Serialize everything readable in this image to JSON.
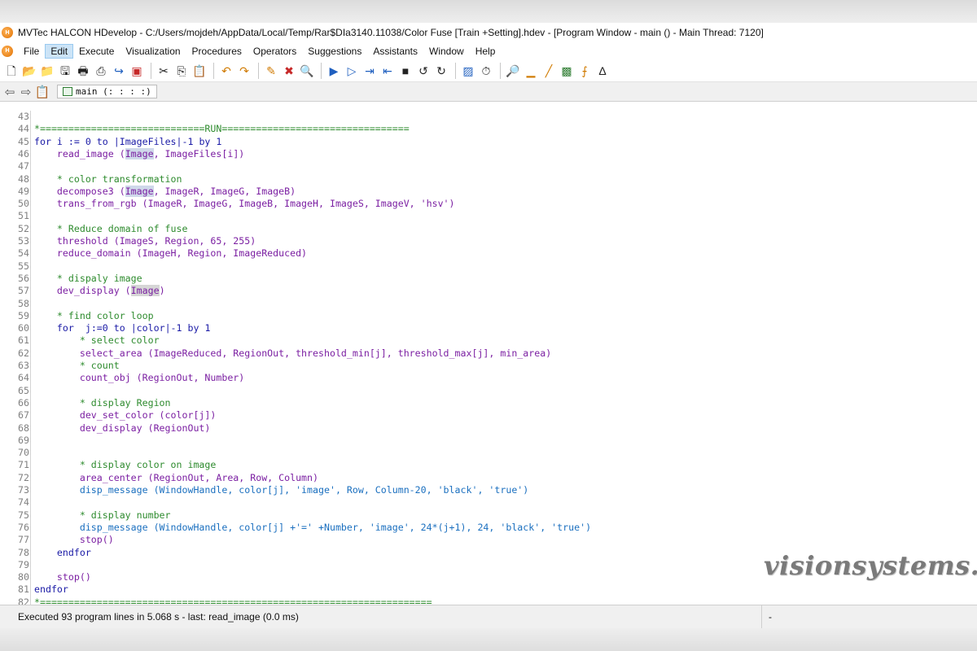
{
  "window": {
    "title": "MVTec HALCON HDevelop - C:/Users/mojdeh/AppData/Local/Temp/Rar$DIa3140.11038/Color Fuse [Train +Setting].hdev - [Program Window - main () - Main Thread: 7120]"
  },
  "menu": [
    "File",
    "Edit",
    "Execute",
    "Visualization",
    "Procedures",
    "Operators",
    "Suggestions",
    "Assistants",
    "Window",
    "Help"
  ],
  "menu_active": "Edit",
  "toolbar_icons": [
    "new-file-icon",
    "open-file-icon",
    "open-folder-icon",
    "save-icon",
    "print-icon",
    "print-preview-icon",
    "export-icon",
    "insert-procedure-icon",
    "cut-icon",
    "copy-icon",
    "paste-icon",
    "undo-icon",
    "redo-icon",
    "edit-procedure-icon",
    "delete-procedure-icon",
    "binoculars-icon",
    "run-icon",
    "step-over-icon",
    "step-into-icon",
    "step-out-icon",
    "stop-icon",
    "reset-program-icon",
    "reset-procedure-icon",
    "active-window-icon",
    "timer-icon",
    "zoom-icon",
    "histogram-icon",
    "line-profile-icon",
    "feature-inspection-icon",
    "ocr-icon",
    "variable-icon"
  ],
  "navigation": {
    "tab_label": "main (: : : :)"
  },
  "code_lines": [
    {
      "n": "43",
      "segments": []
    },
    {
      "n": "44",
      "segments": [
        {
          "t": "*=============================RUN=================================",
          "c": "sep"
        }
      ]
    },
    {
      "n": "45",
      "segments": [
        {
          "t": "for",
          "c": "kw"
        },
        {
          "t": " i := 0 ",
          "c": "op"
        },
        {
          "t": "to",
          "c": "kw"
        },
        {
          "t": " |ImageFiles|-1 ",
          "c": "op"
        },
        {
          "t": "by",
          "c": "kw"
        },
        {
          "t": " 1",
          "c": "op"
        }
      ]
    },
    {
      "n": "46",
      "segments": [
        {
          "t": "    read_image (",
          "c": "fn"
        },
        {
          "t": "Image",
          "c": "fnhl"
        },
        {
          "t": ", ImageFiles[i])",
          "c": "fn"
        }
      ]
    },
    {
      "n": "47",
      "segments": []
    },
    {
      "n": "48",
      "segments": [
        {
          "t": "    * color transformation",
          "c": "cm"
        }
      ]
    },
    {
      "n": "49",
      "segments": [
        {
          "t": "    decompose3 (",
          "c": "fn"
        },
        {
          "t": "Image",
          "c": "fnhl"
        },
        {
          "t": ", ImageR, ImageG, ImageB)",
          "c": "fn"
        }
      ]
    },
    {
      "n": "50",
      "segments": [
        {
          "t": "    trans_from_rgb (ImageR, ImageG, ImageB, ImageH, ImageS, ImageV, 'hsv')",
          "c": "fn"
        }
      ]
    },
    {
      "n": "51",
      "segments": []
    },
    {
      "n": "52",
      "segments": [
        {
          "t": "    * Reduce domain of fuse",
          "c": "cm"
        }
      ]
    },
    {
      "n": "53",
      "segments": [
        {
          "t": "    threshold (ImageS, Region, 65, 255)",
          "c": "fn"
        }
      ]
    },
    {
      "n": "54",
      "segments": [
        {
          "t": "    reduce_domain (ImageH, Region, ImageReduced)",
          "c": "fn"
        }
      ]
    },
    {
      "n": "55",
      "segments": []
    },
    {
      "n": "56",
      "segments": [
        {
          "t": "    * dispaly image",
          "c": "cm"
        }
      ]
    },
    {
      "n": "57",
      "segments": [
        {
          "t": "    dev_display (",
          "c": "fn"
        },
        {
          "t": "Image",
          "c": "fnhl2"
        },
        {
          "t": ")",
          "c": "fn"
        }
      ]
    },
    {
      "n": "58",
      "segments": []
    },
    {
      "n": "59",
      "segments": [
        {
          "t": "    * find color loop",
          "c": "cm"
        }
      ]
    },
    {
      "n": "60",
      "segments": [
        {
          "t": "    for",
          "c": "kw"
        },
        {
          "t": "  j:=0 ",
          "c": "op"
        },
        {
          "t": "to",
          "c": "kw"
        },
        {
          "t": " |color|-1 ",
          "c": "op"
        },
        {
          "t": "by",
          "c": "kw"
        },
        {
          "t": " 1",
          "c": "op"
        }
      ]
    },
    {
      "n": "61",
      "segments": [
        {
          "t": "        * select color",
          "c": "cm"
        }
      ]
    },
    {
      "n": "62",
      "segments": [
        {
          "t": "        select_area (ImageReduced, RegionOut, threshold_min[j], threshold_max[j], min_area)",
          "c": "fn"
        }
      ]
    },
    {
      "n": "63",
      "segments": [
        {
          "t": "        * count",
          "c": "cm"
        }
      ]
    },
    {
      "n": "64",
      "segments": [
        {
          "t": "        count_obj (RegionOut, Number)",
          "c": "fn"
        }
      ]
    },
    {
      "n": "65",
      "segments": []
    },
    {
      "n": "66",
      "segments": [
        {
          "t": "        * display Region",
          "c": "cm"
        }
      ]
    },
    {
      "n": "67",
      "segments": [
        {
          "t": "        dev_set_color (color[j])",
          "c": "fn"
        }
      ]
    },
    {
      "n": "68",
      "segments": [
        {
          "t": "        dev_display (RegionOut)",
          "c": "fn"
        }
      ]
    },
    {
      "n": "69",
      "segments": []
    },
    {
      "n": "70",
      "segments": []
    },
    {
      "n": "71",
      "segments": [
        {
          "t": "        * display color on image",
          "c": "cm"
        }
      ]
    },
    {
      "n": "72",
      "segments": [
        {
          "t": "        area_center (RegionOut, Area, Row, Column)",
          "c": "fn"
        }
      ]
    },
    {
      "n": "73",
      "segments": [
        {
          "t": "        disp_message (WindowHandle, color[j], 'image', Row, Column-20, 'black', 'true')",
          "c": "str"
        }
      ]
    },
    {
      "n": "74",
      "segments": []
    },
    {
      "n": "75",
      "segments": [
        {
          "t": "        * display number",
          "c": "cm"
        }
      ]
    },
    {
      "n": "76",
      "segments": [
        {
          "t": "        disp_message (WindowHandle, color[j] +'=' +Number, 'image', 24*(j+1), 24, 'black', 'true')",
          "c": "str"
        }
      ]
    },
    {
      "n": "77",
      "segments": [
        {
          "t": "        stop()",
          "c": "fn"
        }
      ]
    },
    {
      "n": "78",
      "segments": [
        {
          "t": "    endfor",
          "c": "kw"
        }
      ]
    },
    {
      "n": "79",
      "segments": []
    },
    {
      "n": "80",
      "segments": [
        {
          "t": "    stop()",
          "c": "fn"
        }
      ]
    },
    {
      "n": "81",
      "segments": [
        {
          "t": "endfor",
          "c": "kw"
        }
      ]
    },
    {
      "n": "82",
      "segments": [
        {
          "t": "*=====================================================================",
          "c": "sep"
        }
      ]
    }
  ],
  "watermark": "visionsystems.ir",
  "status": {
    "message": "Executed 93 program lines in 5.068 s - last: read_image (0.0 ms)",
    "side": "-"
  }
}
